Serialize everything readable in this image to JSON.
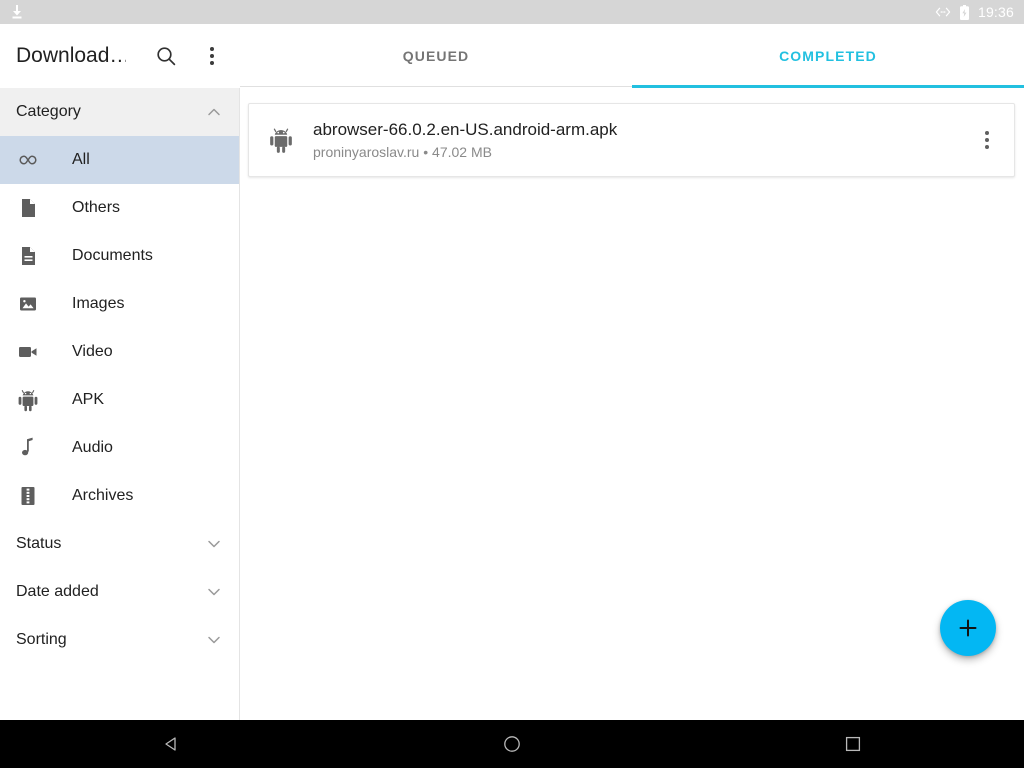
{
  "statusbar": {
    "left_icon": "download-icon",
    "usb_icon": "usb-debug-icon",
    "battery_icon": "battery-charging-icon",
    "time": "19:36",
    "background": "#d6d6d6"
  },
  "appbar": {
    "title": "Download…",
    "search_icon": "search-icon",
    "overflow_icon": "more-vertical-icon",
    "tabs": [
      {
        "label": "QUEUED",
        "active": false
      },
      {
        "label": "COMPLETED",
        "active": true
      }
    ],
    "accent_color": "#22c0e0"
  },
  "sidebar": {
    "sections": [
      {
        "label": "Category",
        "expanded": true,
        "chevron": "chevron-up-icon"
      },
      {
        "label": "Status",
        "expanded": false,
        "chevron": "chevron-down-icon"
      },
      {
        "label": "Date added",
        "expanded": false,
        "chevron": "chevron-down-icon"
      },
      {
        "label": "Sorting",
        "expanded": false,
        "chevron": "chevron-down-icon"
      }
    ],
    "categories": [
      {
        "label": "All",
        "icon": "infinity-icon",
        "selected": true
      },
      {
        "label": "Others",
        "icon": "file-icon",
        "selected": false
      },
      {
        "label": "Documents",
        "icon": "document-icon",
        "selected": false
      },
      {
        "label": "Images",
        "icon": "image-icon",
        "selected": false
      },
      {
        "label": "Video",
        "icon": "video-camera-icon",
        "selected": false
      },
      {
        "label": "APK",
        "icon": "android-icon",
        "selected": false
      },
      {
        "label": "Audio",
        "icon": "music-note-icon",
        "selected": false
      },
      {
        "label": "Archives",
        "icon": "archive-icon",
        "selected": false
      }
    ],
    "selected_background": "#ccd9e9"
  },
  "downloads": [
    {
      "icon": "android-icon",
      "filename": "abrowser-66.0.2.en-US.android-arm.apk",
      "source": "proninyaroslav.ru",
      "separator": "•",
      "size": "47.02 MB",
      "subtitle": "proninyaroslav.ru • 47.02 MB",
      "menu_icon": "more-vertical-icon"
    }
  ],
  "fab": {
    "icon": "plus-icon",
    "color": "#03b7f3"
  },
  "navbar": {
    "buttons": [
      {
        "name": "back",
        "icon": "triangle-left-icon"
      },
      {
        "name": "home",
        "icon": "circle-icon"
      },
      {
        "name": "recents",
        "icon": "square-icon"
      }
    ]
  }
}
